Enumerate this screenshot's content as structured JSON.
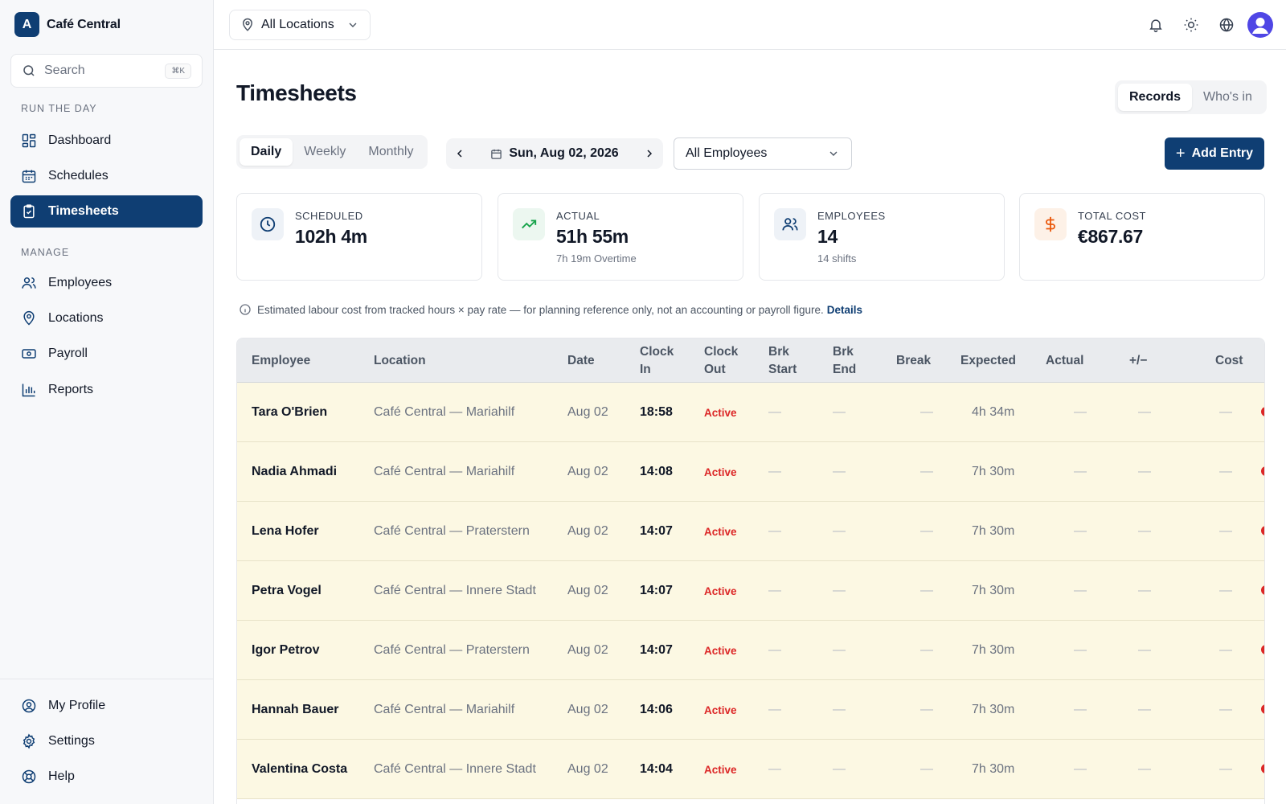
{
  "brand": {
    "initial": "A",
    "name": "Café Central"
  },
  "search": {
    "placeholder": "Search",
    "shortcut": "⌘K"
  },
  "sidebar": {
    "sections": [
      {
        "label": "RUN THE DAY",
        "items": [
          "Dashboard",
          "Schedules",
          "Timesheets"
        ]
      },
      {
        "label": "MANAGE",
        "items": [
          "Employees",
          "Locations",
          "Payroll",
          "Reports"
        ]
      }
    ],
    "active": "Timesheets",
    "bottom": [
      "My Profile",
      "Settings",
      "Help"
    ]
  },
  "topbar": {
    "location_filter": "All Locations"
  },
  "page": {
    "title": "Timesheets",
    "view_toggle": [
      "Records",
      "Who's in"
    ],
    "view_selected": "Records",
    "period_tabs": [
      "Daily",
      "Weekly",
      "Monthly"
    ],
    "period_selected": "Daily",
    "date": "Sun, Aug 02, 2026",
    "employee_filter": "All Employees",
    "add_entry": "Add Entry"
  },
  "stats": [
    {
      "label": "SCHEDULED",
      "value": "102h 4m",
      "sub": ""
    },
    {
      "label": "ACTUAL",
      "value": "51h 55m",
      "sub": "7h 19m Overtime"
    },
    {
      "label": "EMPLOYEES",
      "value": "14",
      "sub": "14 shifts"
    },
    {
      "label": "TOTAL COST",
      "value": "€867.67",
      "sub": ""
    }
  ],
  "notice": {
    "text": "Estimated labour cost from tracked hours × pay rate — for planning reference only, not an accounting or payroll figure.",
    "link": "Details"
  },
  "table": {
    "columns": [
      "Employee",
      "Location",
      "Date",
      "Clock In",
      "Clock Out",
      "Brk Start",
      "Brk End",
      "Break",
      "Expected",
      "Actual",
      "+/−",
      "Cost"
    ],
    "rows": [
      {
        "employee": "Tara O'Brien",
        "location": "Café Central — Mariahilf",
        "date": "Aug 02",
        "clock_in": "18:58",
        "clock_out": "Active",
        "brk_start": "—",
        "brk_end": "—",
        "break": "—",
        "expected": "4h 34m",
        "actual": "—",
        "diff": "—",
        "cost": "—"
      },
      {
        "employee": "Nadia Ahmadi",
        "location": "Café Central — Mariahilf",
        "date": "Aug 02",
        "clock_in": "14:08",
        "clock_out": "Active",
        "brk_start": "—",
        "brk_end": "—",
        "break": "—",
        "expected": "7h 30m",
        "actual": "—",
        "diff": "—",
        "cost": "—"
      },
      {
        "employee": "Lena Hofer",
        "location": "Café Central — Praterstern",
        "date": "Aug 02",
        "clock_in": "14:07",
        "clock_out": "Active",
        "brk_start": "—",
        "brk_end": "—",
        "break": "—",
        "expected": "7h 30m",
        "actual": "—",
        "diff": "—",
        "cost": "—"
      },
      {
        "employee": "Petra Vogel",
        "location": "Café Central — Innere Stadt",
        "date": "Aug 02",
        "clock_in": "14:07",
        "clock_out": "Active",
        "brk_start": "—",
        "brk_end": "—",
        "break": "—",
        "expected": "7h 30m",
        "actual": "—",
        "diff": "—",
        "cost": "—"
      },
      {
        "employee": "Igor Petrov",
        "location": "Café Central — Praterstern",
        "date": "Aug 02",
        "clock_in": "14:07",
        "clock_out": "Active",
        "brk_start": "—",
        "brk_end": "—",
        "break": "—",
        "expected": "7h 30m",
        "actual": "—",
        "diff": "—",
        "cost": "—"
      },
      {
        "employee": "Hannah Bauer",
        "location": "Café Central — Mariahilf",
        "date": "Aug 02",
        "clock_in": "14:06",
        "clock_out": "Active",
        "brk_start": "—",
        "brk_end": "—",
        "break": "—",
        "expected": "7h 30m",
        "actual": "—",
        "diff": "—",
        "cost": "—"
      },
      {
        "employee": "Valentina Costa",
        "location": "Café Central — Innere Stadt",
        "date": "Aug 02",
        "clock_in": "14:04",
        "clock_out": "Active",
        "brk_start": "—",
        "brk_end": "—",
        "break": "—",
        "expected": "7h 30m",
        "actual": "—",
        "diff": "—",
        "cost": "—"
      }
    ]
  },
  "colors": {
    "primary": "#0f3e73",
    "active_status": "#dc2626",
    "row_highlight": "#fcf8e3"
  }
}
